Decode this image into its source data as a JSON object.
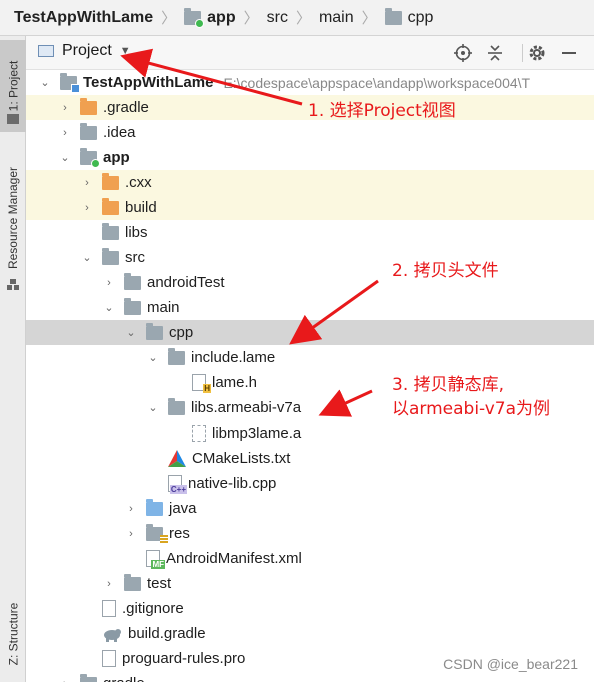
{
  "breadcrumb": [
    {
      "label": "TestAppWithLame",
      "bold": true,
      "icon": "module-folder-icon"
    },
    {
      "label": "app",
      "bold": true,
      "icon": "module-folder-icon"
    },
    {
      "label": "src"
    },
    {
      "label": "main"
    },
    {
      "label": "cpp",
      "icon": "folder-icon"
    }
  ],
  "side_tabs": {
    "project": "1: Project",
    "resource_manager": "Resource Manager",
    "structure": "Z: Structure"
  },
  "tool_window": {
    "title": "Project",
    "icons": [
      "locate-icon",
      "collapse-all-icon",
      "gear-icon",
      "minimize-icon"
    ]
  },
  "tree": {
    "root_name": "TestAppWithLame",
    "root_path": "E:\\codespace\\appspace\\andapp\\workspace004\\T",
    "gradle": ".gradle",
    "idea": ".idea",
    "app": "app",
    "cxx": ".cxx",
    "build_dir": "build",
    "libs": "libs",
    "src": "src",
    "android_test": "androidTest",
    "main": "main",
    "cpp": "cpp",
    "include_lame": "include.lame",
    "lame_h": "lame.h",
    "libs_armeabi": "libs.armeabi-v7a",
    "libmp3lame": "libmp3lame.a",
    "cmakelists": "CMakeLists.txt",
    "native_lib": "native-lib.cpp",
    "java": "java",
    "res": "res",
    "manifest": "AndroidManifest.xml",
    "test": "test",
    "gitignore": ".gitignore",
    "build_gradle": "build.gradle",
    "proguard": "proguard-rules.pro",
    "gradle_bottom": "gradle"
  },
  "badges": {
    "h": "H",
    "cpp": "C++",
    "mf": "MF"
  },
  "annotations": {
    "step1": "1. 选择Project视图",
    "step2": "2. 拷贝头文件",
    "step3_line1": "3. 拷贝静态库,",
    "step3_line2": "以armeabi-v7a为例"
  },
  "watermark": "CSDN @ice_bear221",
  "colors": {
    "annotation_red": "#e8191b",
    "selection_grey": "#d5d5d5",
    "excluded_yellow": "#fbf8e0",
    "folder_orange": "#f0a050",
    "folder_blue": "#7fb4e6"
  }
}
